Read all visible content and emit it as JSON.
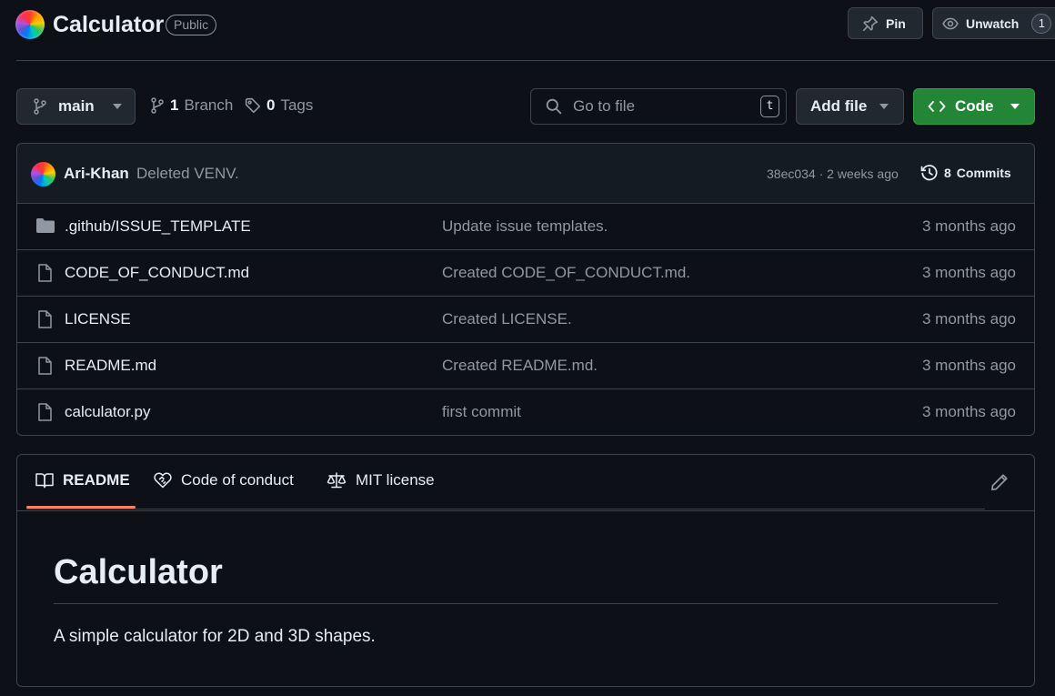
{
  "repo": {
    "name": "Calculator",
    "visibility": "Public",
    "pin_label": "Pin",
    "unwatch_label": "Unwatch",
    "watch_count": "1"
  },
  "toolbar": {
    "branch": "main",
    "branch_count": "1",
    "branch_label": "Branch",
    "tag_count": "0",
    "tag_label": "Tags",
    "goto_placeholder": "Go to file",
    "goto_shortcut": "t",
    "add_file_label": "Add file",
    "code_label": "Code"
  },
  "latest_commit": {
    "author": "Ari-Khan",
    "message": "Deleted VENV.",
    "meta": "38ec034 · 2 weeks ago",
    "commits_count": "8",
    "commits_label": "Commits"
  },
  "files": [
    {
      "name": ".github/ISSUE_TEMPLATE",
      "type": "folder",
      "commit": "Update issue templates.",
      "time": "3 months ago"
    },
    {
      "name": "CODE_OF_CONDUCT.md",
      "type": "file",
      "commit": "Created CODE_OF_CONDUCT.md.",
      "time": "3 months ago"
    },
    {
      "name": "LICENSE",
      "type": "file",
      "commit": "Created LICENSE.",
      "time": "3 months ago"
    },
    {
      "name": "README.md",
      "type": "file",
      "commit": "Created README.md.",
      "time": "3 months ago"
    },
    {
      "name": "calculator.py",
      "type": "file",
      "commit": "first commit",
      "time": "3 months ago"
    }
  ],
  "readme": {
    "tabs": [
      {
        "label": "README",
        "icon": "book-icon",
        "active": true
      },
      {
        "label": "Code of conduct",
        "icon": "code-of-conduct-icon",
        "active": false
      },
      {
        "label": "MIT license",
        "icon": "scale-icon",
        "active": false
      }
    ],
    "heading": "Calculator",
    "description": "A simple calculator for 2D and 3D shapes."
  },
  "colors": {
    "background": "#0d1117",
    "border": "#3d444d",
    "code_button": "#238636",
    "active_tab": "#f78166",
    "muted_text": "#9198a1"
  }
}
